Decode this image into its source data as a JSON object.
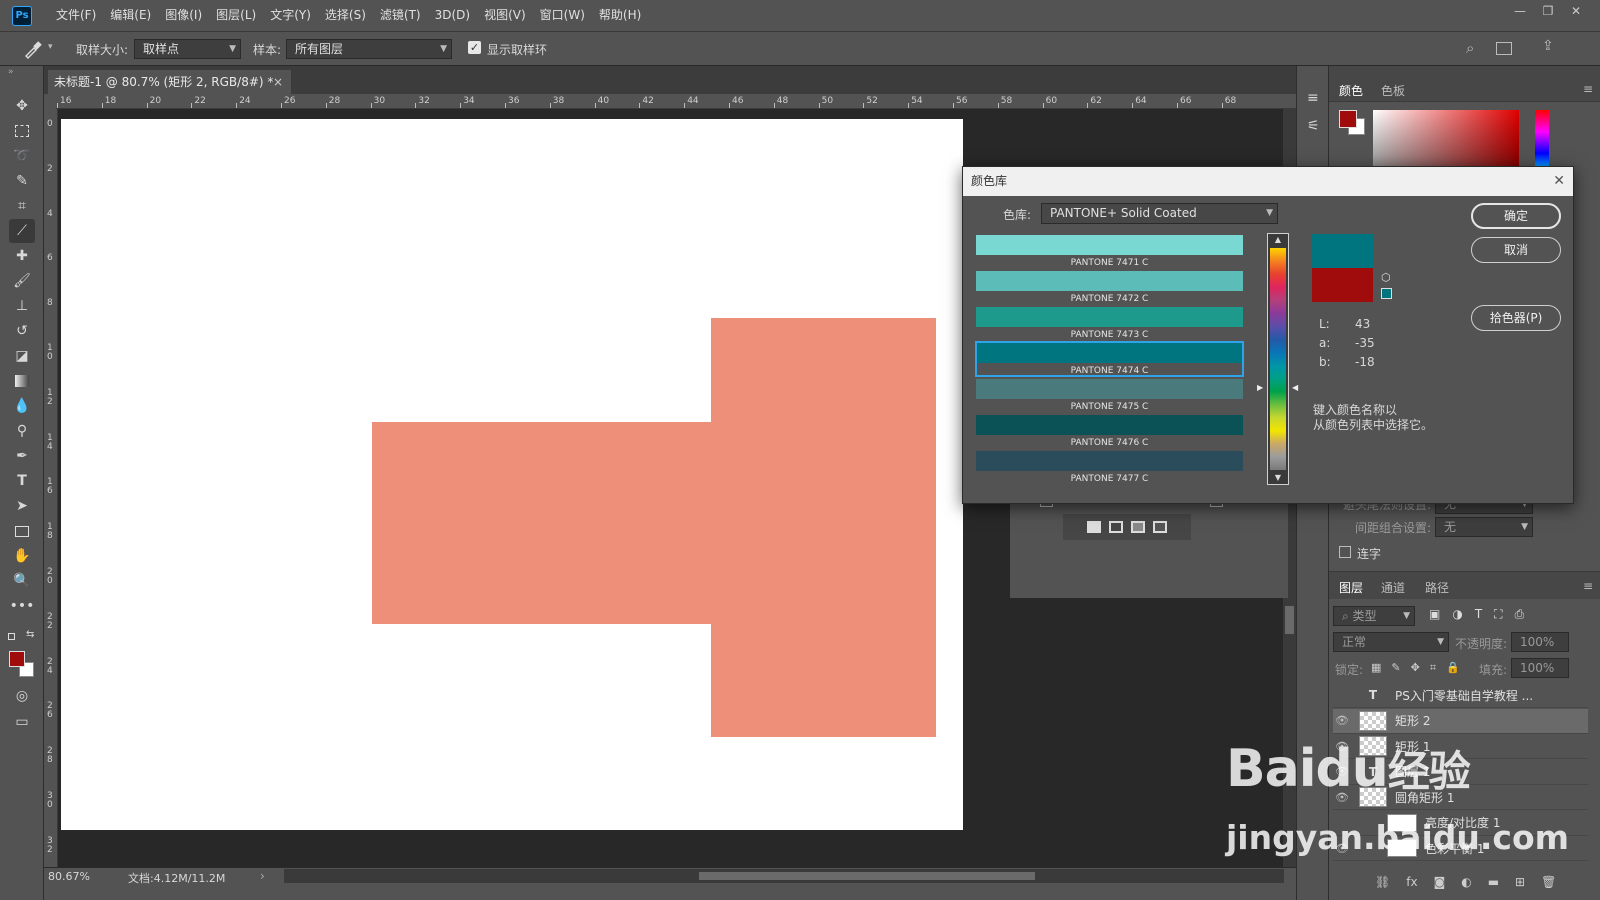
{
  "app": {
    "logo": "Ps"
  },
  "menu": [
    "文件(F)",
    "编辑(E)",
    "图像(I)",
    "图层(L)",
    "文字(Y)",
    "选择(S)",
    "滤镜(T)",
    "3D(D)",
    "视图(V)",
    "窗口(W)",
    "帮助(H)"
  ],
  "window_controls": {
    "minimize": "—",
    "restore": "❐",
    "close": "✕"
  },
  "options": {
    "sample_size_label": "取样大小:",
    "sample_size_value": "取样点",
    "sample_label": "样本:",
    "sample_value": "所有图层",
    "show_ring_label": "显示取样环",
    "show_ring_checked": true
  },
  "doc_tab": {
    "title": "未标题-1 @ 80.7% (矩形 2, RGB/8#) *",
    "close": "×"
  },
  "ruler_h": [
    "16",
    "18",
    "20",
    "22",
    "24",
    "26",
    "28",
    "30",
    "32",
    "34",
    "36",
    "38",
    "40",
    "42",
    "44",
    "46",
    "48",
    "50",
    "52",
    "54",
    "56",
    "58",
    "60",
    "62",
    "64",
    "66",
    "68"
  ],
  "ruler_v": [
    "0",
    "2",
    "4",
    "6",
    "8",
    "10",
    "12",
    "14",
    "16",
    "18",
    "20",
    "22",
    "24",
    "26",
    "28",
    "30",
    "32"
  ],
  "status": {
    "zoom": "80.67%",
    "doc": "文档:4.12M/11.2M"
  },
  "shape_color": "#ee8f7a",
  "foreground_color": "#a00c0c",
  "right_panel": {
    "color_tabs": [
      "颜色",
      "色板"
    ],
    "para_rows": [
      {
        "label": "避头尾法则设置:",
        "value": "无"
      },
      {
        "label": "间距组合设置:",
        "value": "无"
      }
    ],
    "hyphen_label": "连字",
    "layer_tabs": [
      "图层",
      "通道",
      "路径"
    ],
    "filter_placeholder": "类型",
    "blend_mode": "正常",
    "opacity_label": "不透明度:",
    "opacity_value": "100%",
    "lock_label": "锁定:",
    "fill_label": "填充:",
    "fill_value": "100%",
    "layers": [
      {
        "name": "PS入门零基础自学教程 ...",
        "kind": "text",
        "visible": false
      },
      {
        "name": "矩形 2",
        "kind": "shape",
        "visible": true,
        "selected": true
      },
      {
        "name": "矩形 1",
        "kind": "shape",
        "visible": true
      },
      {
        "name": "图层 1",
        "kind": "text",
        "visible": true
      },
      {
        "name": "圆角矩形 1",
        "kind": "shape",
        "visible": true
      },
      {
        "name": "亮度/对比度 1",
        "kind": "adjustment",
        "visible": false
      },
      {
        "name": "色彩平衡 1",
        "kind": "adjustment",
        "visible": true
      }
    ]
  },
  "dialog": {
    "title": "颜色库",
    "library_label": "色库:",
    "library_value": "PANTONE+ Solid Coated",
    "swatches": [
      {
        "name": "PANTONE 7471 C",
        "color": "#7ad8d2"
      },
      {
        "name": "PANTONE 7472 C",
        "color": "#5bbcb8"
      },
      {
        "name": "PANTONE 7473 C",
        "color": "#1e9a8c"
      },
      {
        "name": "PANTONE 7474 C",
        "color": "#007580",
        "selected": true
      },
      {
        "name": "PANTONE 7475 C",
        "color": "#4a7a7c"
      },
      {
        "name": "PANTONE 7476 C",
        "color": "#0b5257"
      },
      {
        "name": "PANTONE 7477 C",
        "color": "#2a4c5b"
      }
    ],
    "new_color": "#007580",
    "old_color": "#a00c0c",
    "lab": [
      {
        "k": "L:",
        "v": "43"
      },
      {
        "k": "a:",
        "v": "-35"
      },
      {
        "k": "b:",
        "v": "-18"
      }
    ],
    "hint_line1": "键入颜色名称以",
    "hint_line2": "从颜色列表中选择它。",
    "buttons": {
      "ok": "确定",
      "cancel": "取消",
      "picker": "拾色器(P)"
    }
  },
  "watermark": {
    "brand": "Baidu",
    "brand_cn": "经验",
    "url": "jingyan.baidu.com"
  }
}
